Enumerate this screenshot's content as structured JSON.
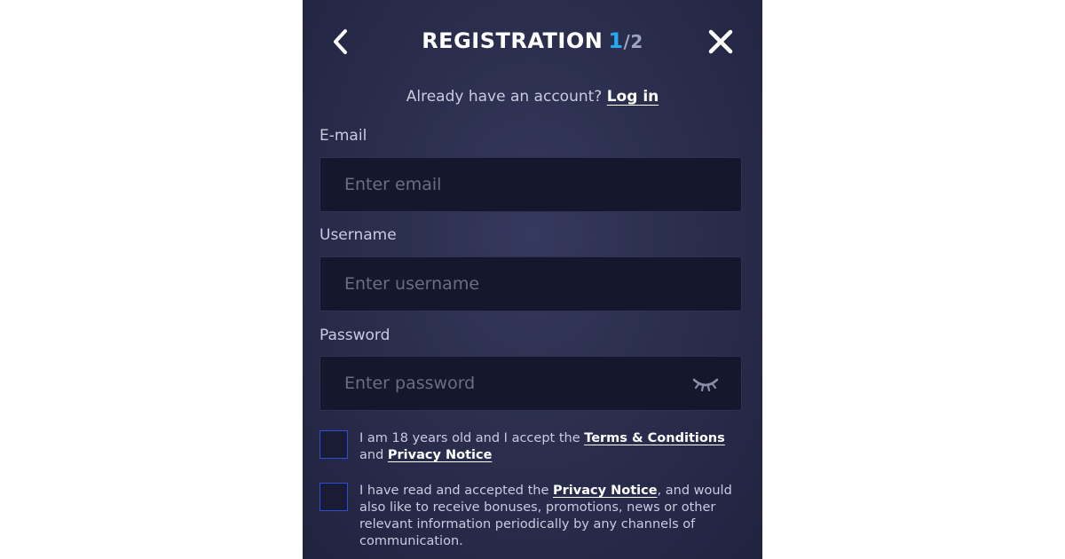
{
  "header": {
    "title": "REGISTRATION",
    "step_current": "1",
    "step_total": "/2",
    "back_icon": "chevron-left-icon",
    "close_icon": "close-icon"
  },
  "login_prompt": {
    "text": "Already have an account?",
    "link": "Log in"
  },
  "form": {
    "email": {
      "label": "E-mail",
      "placeholder": "Enter email",
      "value": ""
    },
    "username": {
      "label": "Username",
      "placeholder": "Enter username",
      "value": ""
    },
    "password": {
      "label": "Password",
      "placeholder": "Enter password",
      "value": "",
      "toggle_icon": "eye-closed-icon"
    }
  },
  "consents": {
    "age": {
      "checked": false,
      "text_before": "I am 18 years old and I accept the ",
      "terms_link": "Terms & Conditions",
      "text_middle": " and ",
      "privacy_link": "Privacy Notice"
    },
    "marketing": {
      "checked": false,
      "text_before": "I have read and accepted the ",
      "privacy_link": "Privacy Notice",
      "text_after": ", and would also like to receive bonuses, promotions, news or other relevant information periodically by any channels of communication."
    }
  },
  "colors": {
    "panel_bg": "#2b2e4d",
    "input_bg": "#15172c",
    "accent": "#27a8f0",
    "checkbox_border": "#2d4fd6"
  }
}
